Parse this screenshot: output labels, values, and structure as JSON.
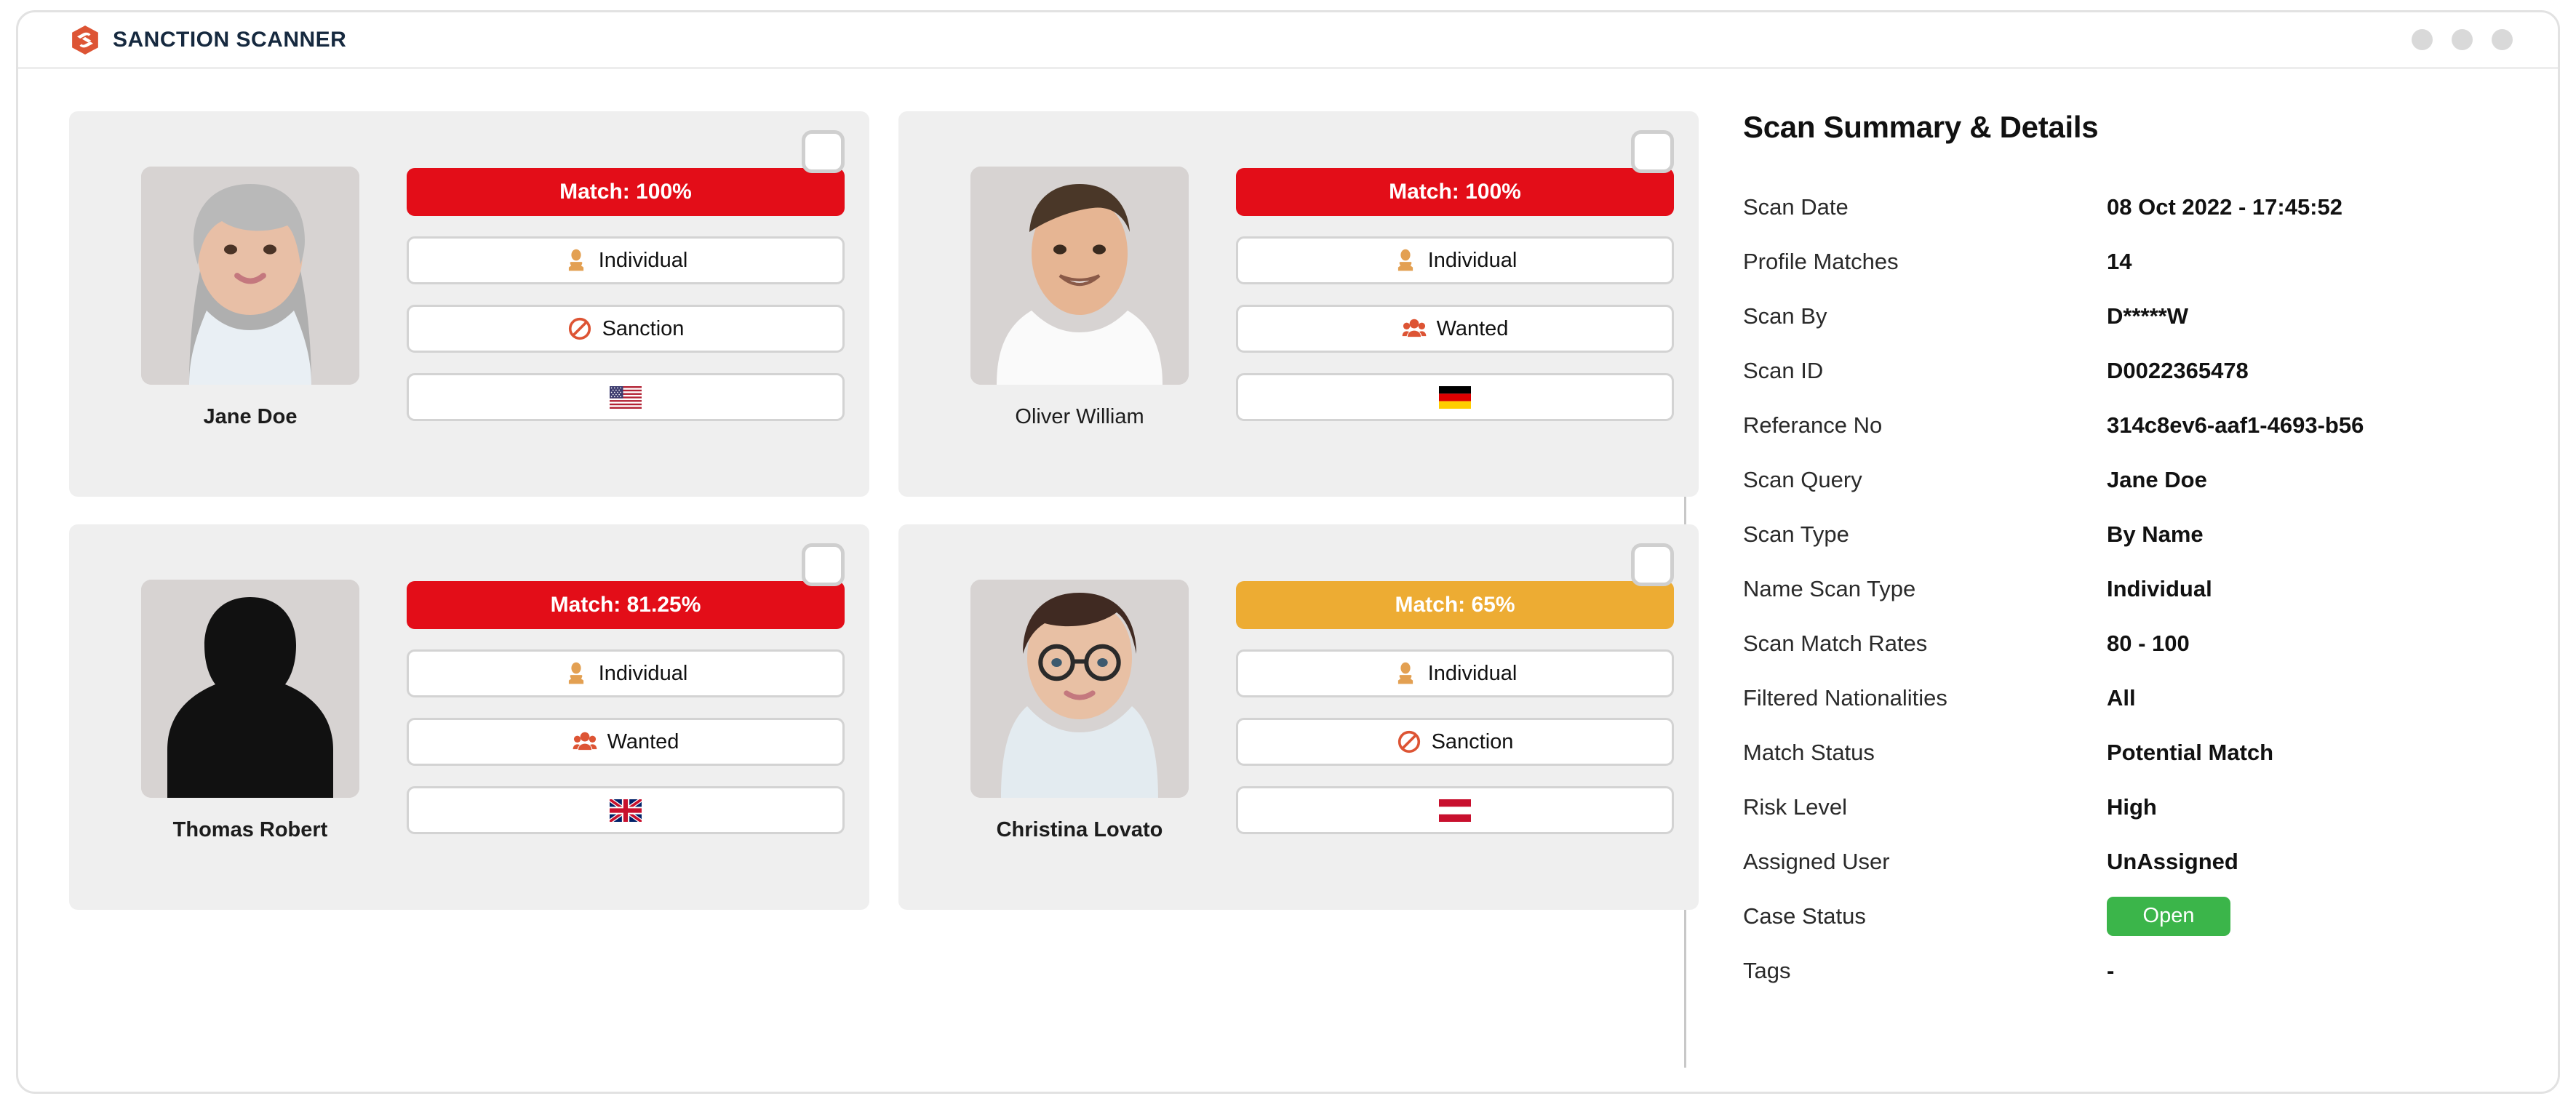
{
  "window": {
    "brand_name": "SANCTION SCANNER",
    "brand_logo_icon": "sanction-scanner-hex-s-logo",
    "controls": [
      "window-dot",
      "window-dot",
      "window-dot"
    ]
  },
  "colors": {
    "brand_orange": "#DD5434",
    "brand_navy": "#16293F",
    "match_high": "#E30D18",
    "match_medium": "#EDAC33",
    "status_open": "#3BB54A",
    "card_bg": "#EFEFEF",
    "pill_border": "#D3D3D3",
    "individual_icon": "#E3A052"
  },
  "matches": [
    {
      "name": "Jane Doe",
      "name_bold": true,
      "avatar": "woman-gray-hair-photo",
      "match_label": "Match: 100%",
      "match_percent": 100,
      "match_color": "#E30D18",
      "entity_type": "Individual",
      "entity_icon": "person-icon",
      "list_type": "Sanction",
      "list_icon": "prohibition-icon",
      "country": "United States",
      "flag_icon": "flag-us",
      "selected": false
    },
    {
      "name": "Oliver William",
      "name_bold": false,
      "avatar": "smiling-man-photo",
      "match_label": "Match: 100%",
      "match_percent": 100,
      "match_color": "#E30D18",
      "entity_type": "Individual",
      "entity_icon": "person-icon",
      "list_type": "Wanted",
      "list_icon": "group-people-icon",
      "country": "Germany",
      "flag_icon": "flag-de",
      "selected": false
    },
    {
      "name": "Thomas Robert",
      "name_bold": true,
      "avatar": "silhouette-man-photo",
      "match_label": "Match: 81.25%",
      "match_percent": 81.25,
      "match_color": "#E30D18",
      "entity_type": "Individual",
      "entity_icon": "person-icon",
      "list_type": "Wanted",
      "list_icon": "group-people-icon",
      "country": "United Kingdom",
      "flag_icon": "flag-gb",
      "selected": false
    },
    {
      "name": "Christina Lovato",
      "name_bold": true,
      "avatar": "woman-glasses-photo",
      "match_label": "Match: 65%",
      "match_percent": 65,
      "match_color": "#EDAC33",
      "entity_type": "Individual",
      "entity_icon": "person-icon",
      "list_type": "Sanction",
      "list_icon": "prohibition-icon",
      "country": "Austria",
      "flag_icon": "flag-at",
      "selected": false
    }
  ],
  "details": {
    "title": "Scan Summary & Details",
    "rows": [
      {
        "label": "Scan Date",
        "value": "08 Oct 2022 - 17:45:52"
      },
      {
        "label": "Profile Matches",
        "value": "14"
      },
      {
        "label": "Scan By",
        "value": "D*****W"
      },
      {
        "label": "Scan ID",
        "value": "D0022365478"
      },
      {
        "label": "Referance No",
        "value": "314c8ev6-aaf1-4693-b56"
      },
      {
        "label": "Scan Query",
        "value": "Jane Doe"
      },
      {
        "label": "Scan Type",
        "value": "By Name"
      },
      {
        "label": "Name Scan Type",
        "value": "Individual"
      },
      {
        "label": "Scan Match Rates",
        "value": "80 - 100"
      },
      {
        "label": "Filtered Nationalities",
        "value": "All"
      },
      {
        "label": "Match Status",
        "value": "Potential Match"
      },
      {
        "label": "Risk Level",
        "value": "High"
      },
      {
        "label": "Assigned User",
        "value": "UnAssigned"
      },
      {
        "label": "Case Status",
        "value": "Open",
        "chip": true
      },
      {
        "label": "Tags",
        "value": "-"
      }
    ]
  }
}
